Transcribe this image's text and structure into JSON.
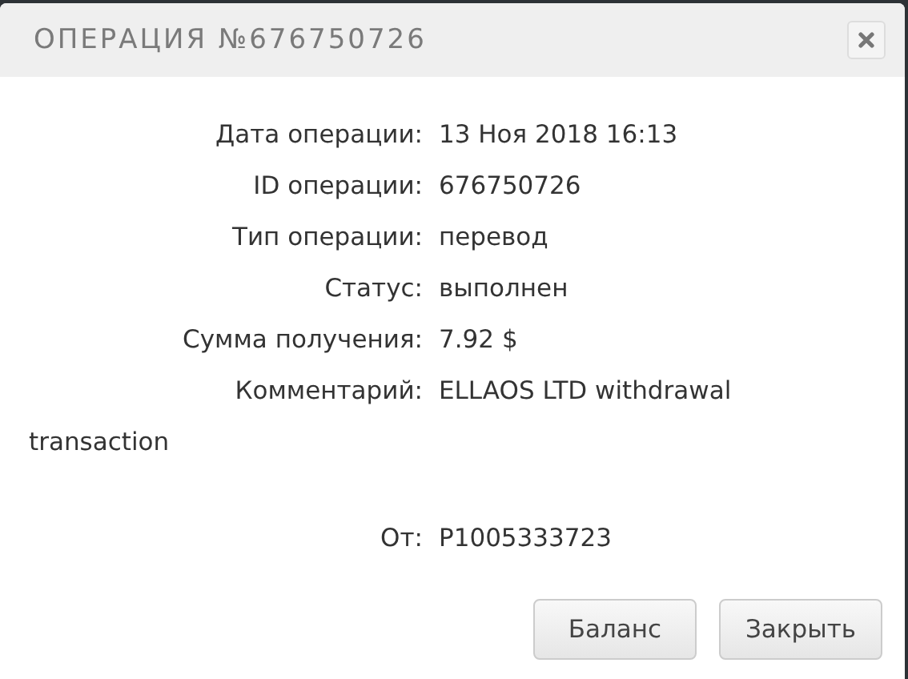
{
  "dialog": {
    "title": "ОПЕРАЦИЯ №676750726"
  },
  "fields": [
    {
      "kind": "row",
      "label": "Дата операции:",
      "value": "13 Ноя 2018 16:13"
    },
    {
      "kind": "row",
      "label": "ID операции:",
      "value": "676750726"
    },
    {
      "kind": "row",
      "label": "Тип операции:",
      "value": "перевод"
    },
    {
      "kind": "row",
      "label": "Статус:",
      "value": "выполнен"
    },
    {
      "kind": "row",
      "label": "Сумма получения:",
      "value": "7.92 $"
    },
    {
      "kind": "wrap",
      "label": "Комментарий:",
      "value": "ELLAOS LTD withdrawal transaction"
    },
    {
      "kind": "spaced",
      "label": "От:",
      "value": "P1005333723"
    }
  ],
  "buttons": [
    "Баланс",
    "Закрыть"
  ]
}
